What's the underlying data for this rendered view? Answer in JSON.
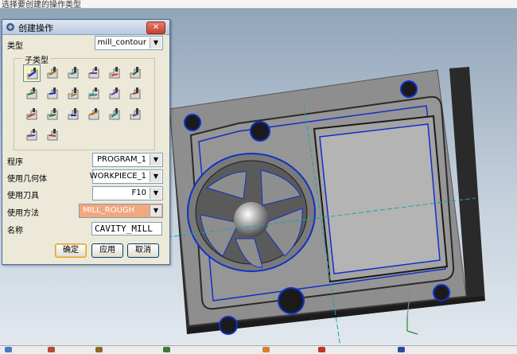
{
  "toolbar_hint": "选择要创建的操作类型",
  "dialog": {
    "title": "创建操作",
    "type_label": "类型",
    "type_value": "mill_contour",
    "subtype_label": "子类型",
    "program_label": "程序",
    "program_value": "PROGRAM_1",
    "geometry_label": "使用几何体",
    "geometry_value": "WORKPIECE_1",
    "tool_label": "使用刀具",
    "tool_value": "F10",
    "method_label": "使用方法",
    "method_value": "MILL_ROUGH",
    "name_label": "名称",
    "name_value": "CAVITY_MILL",
    "ok": "确定",
    "apply": "应用",
    "cancel": "取消",
    "close_glyph": "✕",
    "dropdown_glyph": "▼",
    "subtype_icons": [
      "cavity-mill-icon",
      "plunge-mill-icon",
      "corner-rough-icon",
      "rest-mill-icon",
      "zlevel-profile-icon",
      "zlevel-corner-icon",
      "fixed-contour-icon",
      "contour-area-icon",
      "contour-surface-icon",
      "streamline-icon",
      "contour-non-steep-icon",
      "contour-steep-icon",
      "flowcut-single-icon",
      "flowcut-multiple-icon",
      "flowcut-ref-tool-icon",
      "flowcut-smooth-icon",
      "contour-profile-icon",
      "contour-text-icon",
      "mill-control-icon",
      "mill-user-icon"
    ]
  },
  "colors": {
    "selection_blue": "#1030c8",
    "part_face": "#8e8e8e",
    "part_side": "#2a2a2a",
    "method_highlight": "#f2a77e",
    "axis_cyan": "#1aa6a6"
  }
}
